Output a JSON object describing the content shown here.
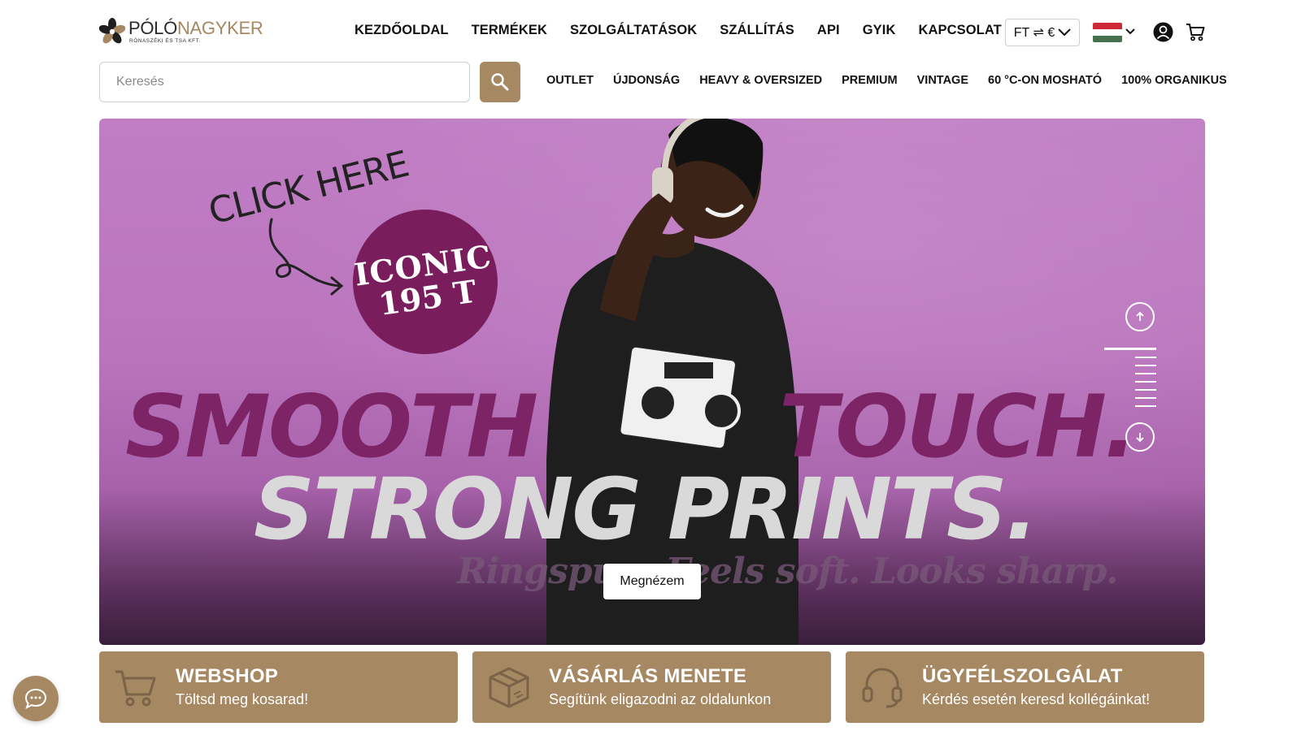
{
  "brand": {
    "name_part1": "PÓLÓ",
    "name_part2": "NAGYKER",
    "subtitle": "RÓNASZÉKI ÉS TSA KFT.",
    "accent_color": "#a68863"
  },
  "main_nav": [
    "KEZDŐOLDAL",
    "TERMÉKEK",
    "SZOLGÁLTATÁSOK",
    "SZÁLLÍTÁS",
    "API",
    "GYIK",
    "KAPCSOLAT"
  ],
  "currency": {
    "label": "FT ⇌ €"
  },
  "language": {
    "flag": "hungary-flag",
    "colors": [
      "#ce2939",
      "#ffffff",
      "#477050"
    ]
  },
  "search": {
    "placeholder": "Keresés",
    "value": ""
  },
  "sub_nav": [
    "OUTLET",
    "ÚJDONSÁG",
    "HEAVY & OVERSIZED",
    "PREMIUM",
    "VINTAGE",
    "60 °C-ON MOSHATÓ",
    "100% ORGANIKUS"
  ],
  "hero": {
    "click_here": "CLICK HERE",
    "badge_line1": "ICONIC",
    "badge_line2": "195 T",
    "headline_1": "SMOOTH",
    "headline_2": "TOUCH.",
    "headline_3": "STRONG PRINTS.",
    "tagline": "Ringspun. Feels soft. Looks sharp.",
    "cta": "Megnézem",
    "slide_count": 8,
    "active_slide": 1
  },
  "cards": [
    {
      "icon": "cart-icon",
      "title": "WEBSHOP",
      "subtitle": "Töltsd meg kosarad!"
    },
    {
      "icon": "package-icon",
      "title": "VÁSÁRLÁS MENETE",
      "subtitle": "Segítünk eligazodni az oldalunkon"
    },
    {
      "icon": "headset-icon",
      "title": "ÜGYFÉLSZOLGÁLAT",
      "subtitle": "Kérdés esetén keresd kollégáinkat!"
    }
  ],
  "chat": {
    "icon": "chat-icon"
  }
}
